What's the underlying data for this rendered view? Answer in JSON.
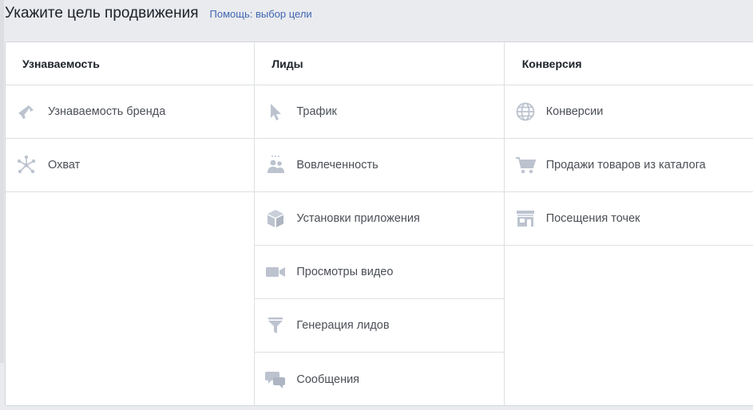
{
  "page": {
    "title": "Укажите цель продвижения",
    "help_link": "Помощь: выбор цели"
  },
  "columns": [
    {
      "header": "Узнаваемость",
      "items": [
        {
          "label": "Узнаваемость бренда",
          "icon": "megaphone-icon"
        },
        {
          "label": "Охват",
          "icon": "reach-icon"
        }
      ]
    },
    {
      "header": "Лиды",
      "items": [
        {
          "label": "Трафик",
          "icon": "cursor-icon"
        },
        {
          "label": "Вовлеченность",
          "icon": "people-icon"
        },
        {
          "label": "Установки приложения",
          "icon": "cube-icon"
        },
        {
          "label": "Просмотры видео",
          "icon": "video-camera-icon"
        },
        {
          "label": "Генерация лидов",
          "icon": "funnel-icon"
        },
        {
          "label": "Сообщения",
          "icon": "chat-bubbles-icon"
        }
      ]
    },
    {
      "header": "Конверсия",
      "items": [
        {
          "label": "Конверсии",
          "icon": "globe-icon"
        },
        {
          "label": "Продажи товаров из каталога",
          "icon": "shopping-cart-icon"
        },
        {
          "label": "Посещения точек",
          "icon": "storefront-icon"
        }
      ]
    }
  ],
  "colors": {
    "icon": "#bcc3cf",
    "link": "#4267b2",
    "text": "#4b4f56",
    "heading": "#1d2129",
    "background": "#e9ebee"
  }
}
